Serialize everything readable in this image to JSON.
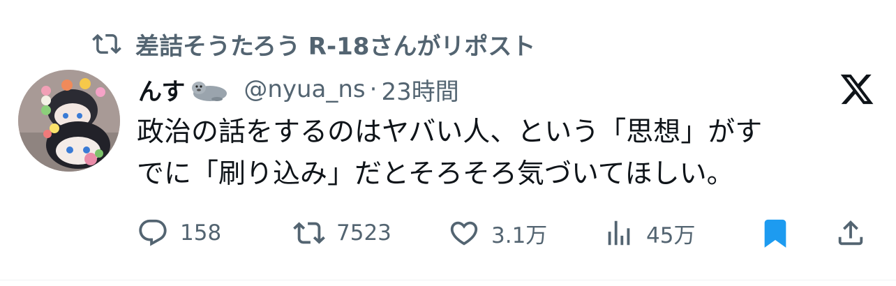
{
  "repost": {
    "icon": "repost-icon",
    "text": "差詰そうたろう R-18さんがリポスト"
  },
  "author": {
    "display_name": "んす",
    "name_emoji": "seal-emoji",
    "handle": "@nyua_ns",
    "separator": "·",
    "time": "23時間"
  },
  "platform_logo": "x-logo-icon",
  "tweet": {
    "line1": "政治の話をするのはヤバい人、という「思想」がす",
    "line2": "でに「刷り込み」だとそろそろ気づいてほしい。"
  },
  "actions": {
    "reply_count": "158",
    "repost_count": "7523",
    "like_count": "3.1万",
    "view_count": "45万"
  },
  "colors": {
    "text": "#0f1419",
    "secondary": "#536471",
    "bookmark_active": "#1d9bf0"
  }
}
